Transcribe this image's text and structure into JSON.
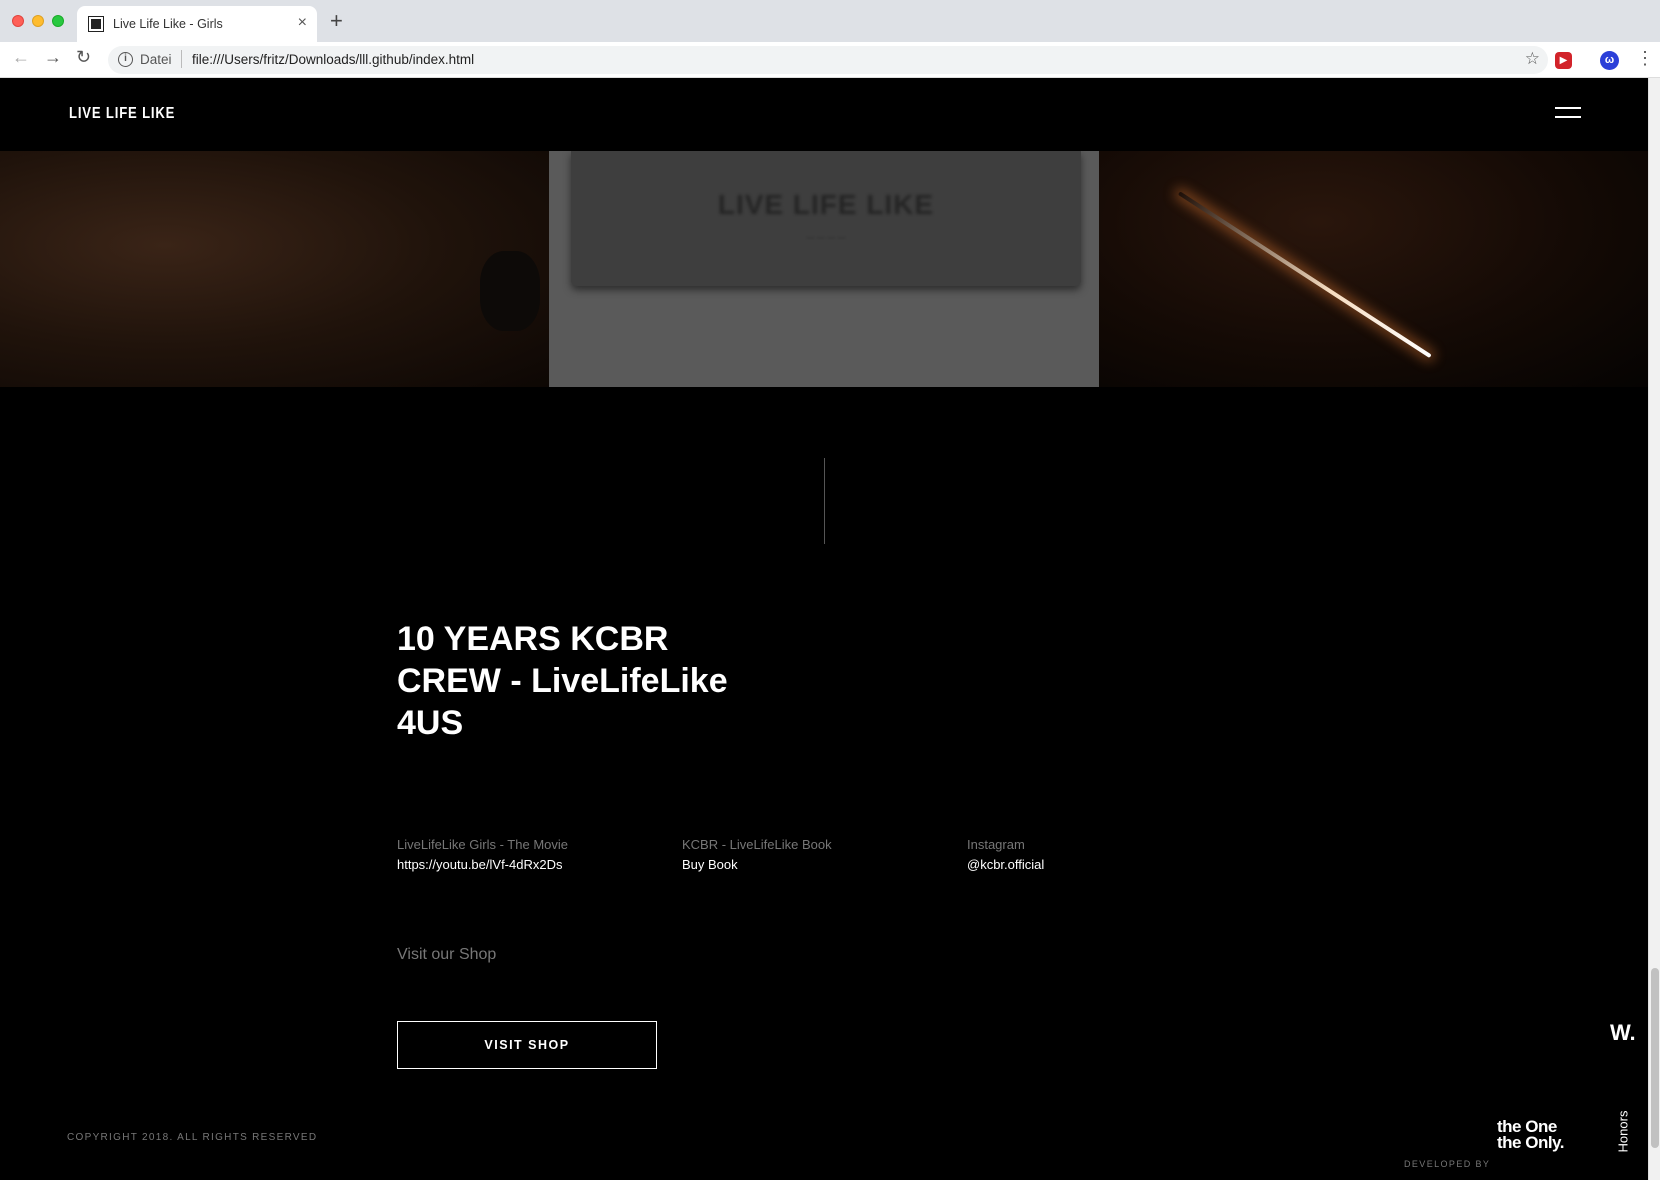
{
  "browser": {
    "tab_title": "Live Life Like - Girls",
    "tab_close": "×",
    "new_tab": "+",
    "back": "←",
    "forward": "→",
    "reload": "↻",
    "url_scheme_label": "Datei",
    "url": "file:///Users/fritz/Downloads/lll.github/index.html",
    "star": "☆",
    "menu": "⋮"
  },
  "site": {
    "logo": "LIVE LIFE LIKE",
    "hero_mid_text": "LIVE LIFE LIKE",
    "title": "10 YEARS KCBR CREW - LiveLifeLike 4US",
    "info": [
      {
        "label": "LiveLifeLike Girls - The Movie",
        "value": "https://youtu.be/lVf-4dRx2Ds"
      },
      {
        "label": "KCBR - LiveLifeLike Book",
        "value": "Buy Book"
      },
      {
        "label": "Instagram",
        "value": "@kcbr.official"
      }
    ],
    "shop_caption": "Visit our Shop",
    "shop_button": "VISIT SHOP",
    "copyright": "COPYRIGHT 2018. ALL RIGHTS RESERVED",
    "w_badge": "W.",
    "honors": "Honors",
    "developer_name_line1": "the One",
    "developer_name_line2": "the Only.",
    "developed_by": "DEVELOPED BY"
  }
}
